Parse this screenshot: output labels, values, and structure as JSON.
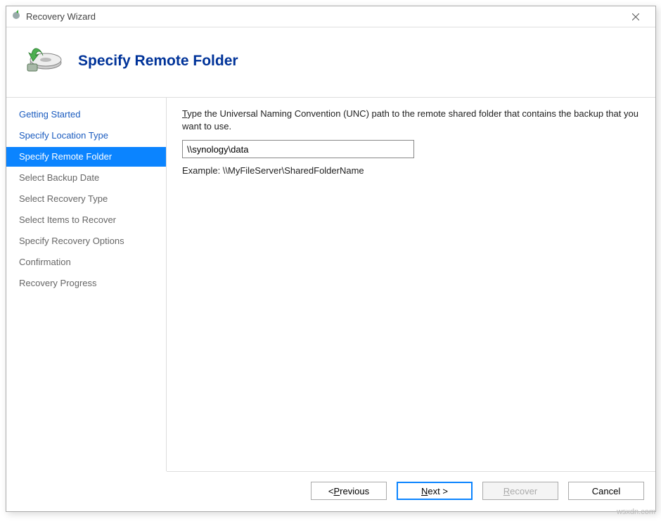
{
  "titlebar": {
    "title": "Recovery Wizard"
  },
  "header": {
    "title": "Specify Remote Folder"
  },
  "sidebar": {
    "steps": [
      {
        "label": "Getting Started",
        "state": "done"
      },
      {
        "label": "Specify Location Type",
        "state": "done"
      },
      {
        "label": "Specify Remote Folder",
        "state": "current"
      },
      {
        "label": "Select Backup Date",
        "state": "pending"
      },
      {
        "label": "Select Recovery Type",
        "state": "pending"
      },
      {
        "label": "Select Items to Recover",
        "state": "pending"
      },
      {
        "label": "Specify Recovery Options",
        "state": "pending"
      },
      {
        "label": "Confirmation",
        "state": "pending"
      },
      {
        "label": "Recovery Progress",
        "state": "pending"
      }
    ]
  },
  "main": {
    "instructions_prefix": "T",
    "instructions_rest": "ype the Universal Naming Convention (UNC) path to the remote shared folder that contains the backup that you want to use.",
    "path_value": "\\\\synology\\data",
    "example_label": "Example: \\\\MyFileServer\\SharedFolderName"
  },
  "footer": {
    "previous_prefix": "< ",
    "previous_key": "P",
    "previous_rest": "revious",
    "next_key": "N",
    "next_rest": "ext >",
    "recover_key": "R",
    "recover_rest": "ecover",
    "cancel": "Cancel"
  },
  "watermark": "wsxdn.com"
}
